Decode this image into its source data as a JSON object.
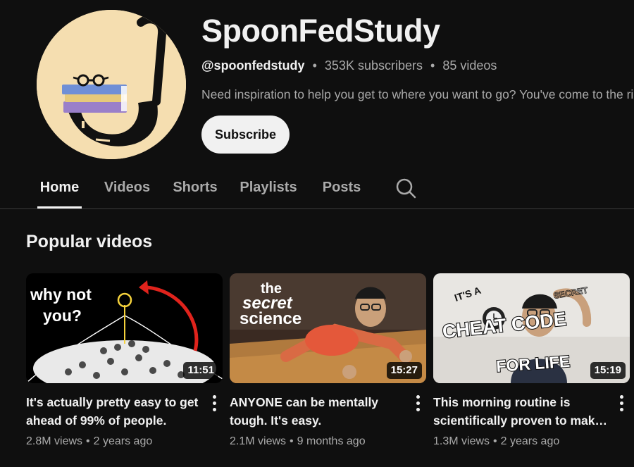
{
  "channel": {
    "name": "SpoonFedStudy",
    "handle": "@spoonfedstudy",
    "subscribers": "353K subscribers",
    "videos": "85 videos",
    "description": "Need inspiration to help you get to where you want to go? You've come to the right place.",
    "subscribe_label": "Subscribe",
    "avatar_bg": "#f5deb0"
  },
  "tabs": [
    {
      "label": "Home",
      "active": true
    },
    {
      "label": "Videos",
      "active": false
    },
    {
      "label": "Shorts",
      "active": false
    },
    {
      "label": "Playlists",
      "active": false
    },
    {
      "label": "Posts",
      "active": false
    }
  ],
  "search_icon": "search-icon",
  "section": {
    "title": "Popular videos"
  },
  "videos": [
    {
      "title": "It's actually pretty easy to get ahead of 99% of people.",
      "views": "2.8M views",
      "age": "2 years ago",
      "duration": "11:51",
      "thumb_text": [
        "why not",
        "you?"
      ]
    },
    {
      "title": "ANYONE can be mentally tough. It's easy.",
      "views": "2.1M views",
      "age": "9 months ago",
      "duration": "15:27",
      "thumb_text": [
        "the",
        "secret",
        "science"
      ]
    },
    {
      "title": "This morning routine is scientifically proven to mak…",
      "views": "1.3M views",
      "age": "2 years ago",
      "duration": "15:19",
      "thumb_text": [
        "IT'S A",
        "SECRET",
        "CHEAT CODE",
        "FOR LIFE"
      ]
    }
  ]
}
